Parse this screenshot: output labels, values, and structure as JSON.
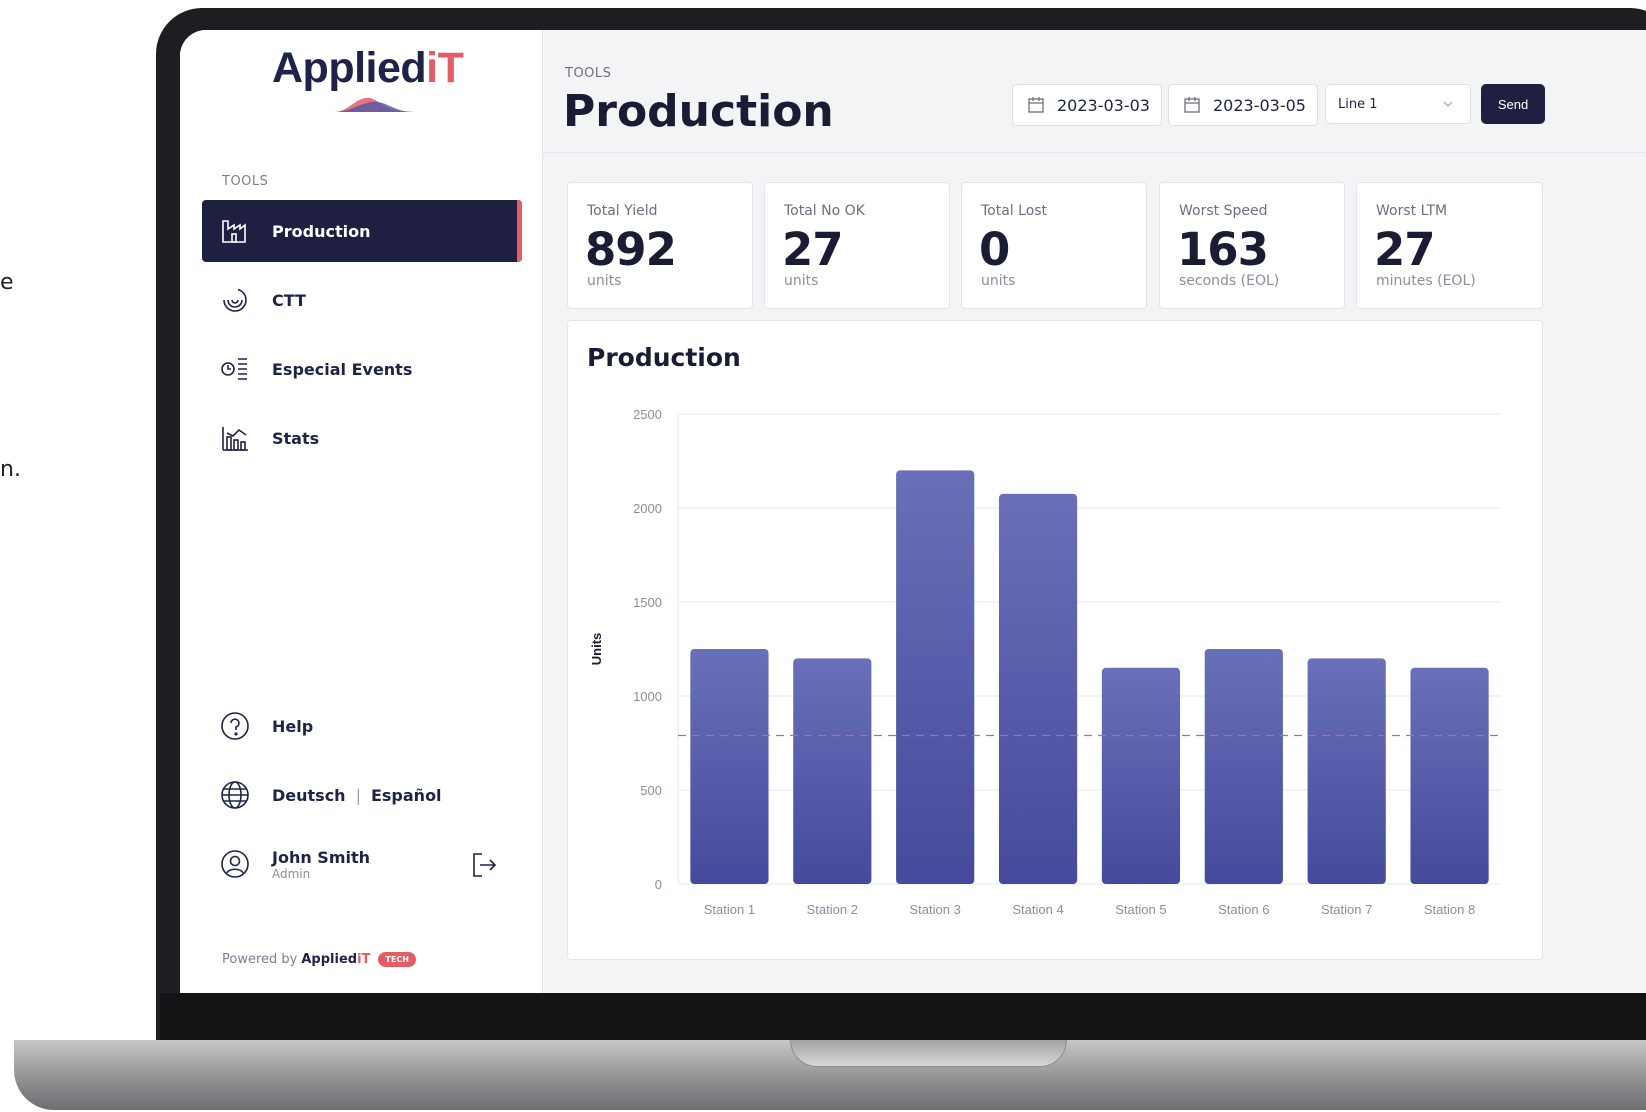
{
  "app": {
    "logo_name": "AppliedIT",
    "logo_brand": "Applied",
    "logo_suffix": "iT",
    "colors": {
      "primary": "#1f2041",
      "accent": "#e35d66",
      "bar": "#5157a6"
    }
  },
  "sidebar": {
    "section_label": "TOOLS",
    "items": [
      {
        "label": "Production",
        "icon": "factory-icon",
        "active": true
      },
      {
        "label": "CTT",
        "icon": "ripple-icon",
        "active": false
      },
      {
        "label": "Especial Events",
        "icon": "clock-list-icon",
        "active": false
      },
      {
        "label": "Stats",
        "icon": "chart-building-icon",
        "active": false
      }
    ],
    "help_label": "Help",
    "languages": [
      "Deutsch",
      "Español"
    ],
    "user": {
      "name": "John Smith",
      "role": "Admin"
    },
    "powered_by_prefix": "Powered by",
    "powered_by_brand": "Applied",
    "powered_by_suffix": "iT",
    "tech_badge": "TECH"
  },
  "header": {
    "breadcrumb": "TOOLS",
    "title": "Production",
    "date_from": "2023-03-03",
    "date_to": "2023-03-05",
    "line_select": "Line 1",
    "send_label": "Send"
  },
  "kpis": [
    {
      "label": "Total Yield",
      "value": "892",
      "unit": "units"
    },
    {
      "label": "Total No OK",
      "value": "27",
      "unit": "units"
    },
    {
      "label": "Total Lost",
      "value": "0",
      "unit": "units"
    },
    {
      "label": "Worst Speed",
      "value": "163",
      "unit": "seconds (EOL)"
    },
    {
      "label": "Worst LTM",
      "value": "27",
      "unit": "minutes (EOL)"
    }
  ],
  "outside_text": [
    "e",
    "n."
  ],
  "chart_data": {
    "type": "bar",
    "title": "Production",
    "ylabel": "Units",
    "xlabel": "",
    "categories": [
      "Station 1",
      "Station 2",
      "Station 3",
      "Station 4",
      "Station 5",
      "Station 6",
      "Station 7",
      "Station 8"
    ],
    "values": [
      1250,
      1200,
      2200,
      2075,
      1150,
      1250,
      1200,
      1150
    ],
    "ylim": [
      0,
      2500
    ],
    "yticks": [
      0,
      500,
      1000,
      1500,
      2000,
      2500
    ],
    "reference_line": 790,
    "grid": true,
    "legend": "none"
  }
}
